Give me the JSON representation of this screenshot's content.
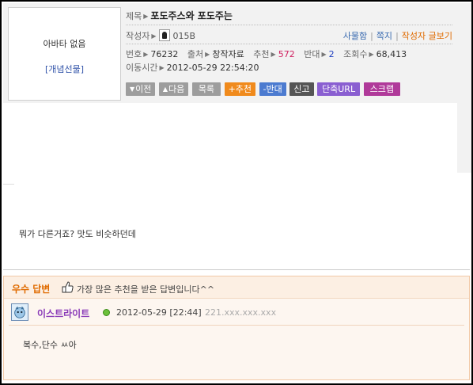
{
  "header": {
    "avatar_text": "아바타 없음",
    "avatar_link": "[개념선물]",
    "title_label": "제목",
    "title": "포도주스와 포도주는",
    "author_label": "작성자",
    "author_nick": "015B",
    "author_links": [
      "사물함",
      "쪽지",
      "작성자 글보기"
    ],
    "meta": {
      "number_label": "번호",
      "number": "76232",
      "source_label": "출처",
      "source": "창작자료",
      "upvote_label": "추천",
      "upvote": "572",
      "downvote_label": "반대",
      "downvote": "2",
      "views_label": "조회수",
      "views": "68,413",
      "moved_label": "이동시간",
      "moved": "2012-05-29 22:54:20"
    },
    "buttons": {
      "prev": "이전",
      "next": "다음",
      "list": "목록",
      "recommend": "추천",
      "oppose": "반대",
      "report": "신고",
      "short_url": "단축URL",
      "scrap": "스크랩"
    }
  },
  "post": {
    "body": "뭐가 다른거죠? 맛도 비슷하던데"
  },
  "best_answer": {
    "label": "우수 답변",
    "description": "가장 많은 추천을 받은 답변입니다^^",
    "author": "이스트라이트",
    "date": "2012-05-29 [22:44]",
    "ip": "221.xxx.xxx.xxx",
    "body": "복수,단수 ㅆ아"
  },
  "colors": {
    "accent_orange": "#e06b00",
    "link_blue": "#3b6bb0",
    "answer_name": "#8a3bb8",
    "upvote": "#d02060"
  }
}
